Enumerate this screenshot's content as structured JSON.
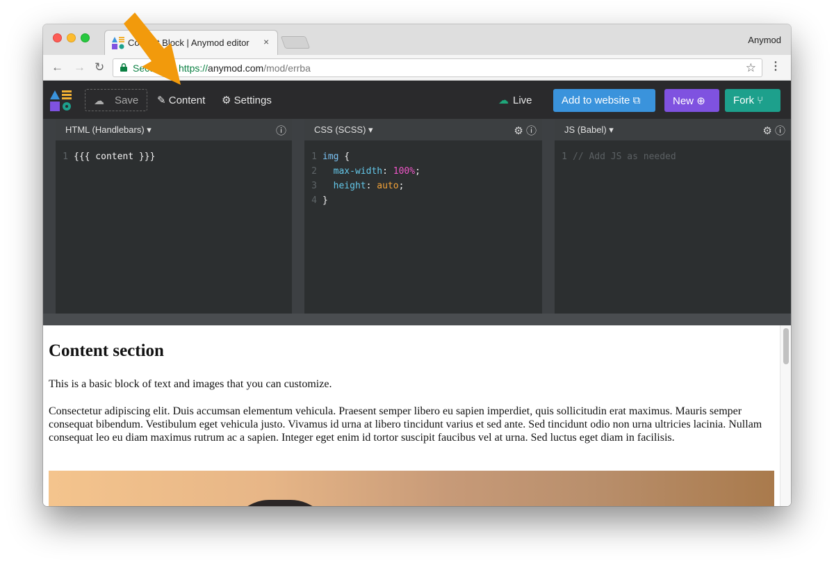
{
  "browser": {
    "tab_title": "Content Block | Anymod editor",
    "tab_close": "×",
    "profile": "Anymod",
    "secure_label": "Secure",
    "url_scheme": "https://",
    "url_host": "anymod.com",
    "url_path": "/mod/errba",
    "icons": [
      "back-icon",
      "forward-icon",
      "reload-icon",
      "lock-icon",
      "star-icon",
      "menu-icon"
    ]
  },
  "toolbar": {
    "save_label": "Save",
    "content_label": "Content",
    "settings_label": "Settings",
    "live_label": "Live",
    "add_label": "Add to website",
    "new_label": "New",
    "fork_label": "Fork"
  },
  "panes": {
    "html": {
      "title": "HTML (Handlebars) ▾",
      "lines": [
        {
          "n": "1",
          "code": "{{{ content }}}"
        }
      ]
    },
    "css": {
      "title": "CSS (SCSS) ▾",
      "lines": [
        {
          "n": "1",
          "sel": "img",
          "rest": " {"
        },
        {
          "n": "2",
          "prop": "  max-width",
          "colon": ": ",
          "num": "100%",
          "end": ";"
        },
        {
          "n": "3",
          "prop": "  height",
          "colon": ": ",
          "val": "auto",
          "end": ";"
        },
        {
          "n": "4",
          "rest": "}"
        }
      ]
    },
    "js": {
      "title": "JS (Babel) ▾",
      "lines": [
        {
          "n": "1",
          "comment": "// Add JS as needed"
        }
      ]
    }
  },
  "preview": {
    "heading": "Content section",
    "intro": "This is a basic block of text and images that you can customize.",
    "body": "Consectetur adipiscing elit. Duis accumsan elementum vehicula. Praesent semper libero eu sapien imperdiet, quis sollicitudin erat maximus. Mauris semper consequat bibendum. Vestibulum eget vehicula justo. Vivamus id urna at libero tincidunt varius et sed ante. Sed tincidunt odio non urna ultricies lacinia. Nullam consequat leo eu diam maximus rutrum ac a sapien. Integer eget enim id tortor suscipit faucibus vel at urna. Sed luctus eget diam in facilisis."
  },
  "colors": {
    "accent_blue": "#3a93dc",
    "accent_purple": "#7f52e0",
    "accent_teal": "#1da08c",
    "annotation_arrow": "#f29a0c"
  }
}
